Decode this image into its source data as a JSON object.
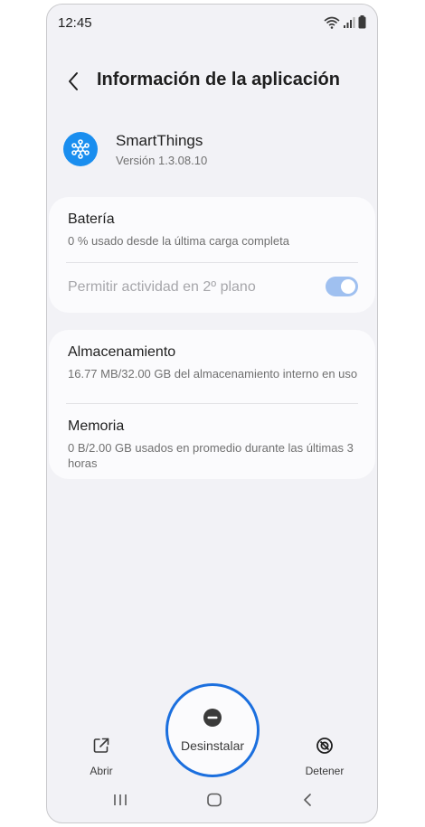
{
  "status_bar": {
    "time": "12:45",
    "icons": [
      "wifi-icon",
      "signal-icon",
      "battery-icon"
    ]
  },
  "header": {
    "title": "Información de la aplicación",
    "back_icon": "chevron-left-icon"
  },
  "app": {
    "name": "SmartThings",
    "version": "Versión 1.3.08.10",
    "icon": "smartthings-logo-icon",
    "icon_color": "#1a8eef"
  },
  "battery_card": {
    "title": "Batería",
    "subtitle": "0 % usado desde la última carga completa",
    "background_toggle_label": "Permitir actividad en 2º plano",
    "background_toggle_on": true
  },
  "storage_card": {
    "storage_title": "Almacenamiento",
    "storage_subtitle": "16.77 MB/32.00 GB del almacenamiento interno en uso",
    "memory_title": "Memoria",
    "memory_subtitle": "0 B/2.00 GB usados en promedio durante las últimas 3 horas"
  },
  "actions": {
    "open_label": "Abrir",
    "uninstall_label": "Desinstalar",
    "stop_label": "Detener"
  },
  "colors": {
    "accent": "#1b6fde",
    "toggle_track": "#9fc0f0",
    "background": "#f2f2f6",
    "card": "#fbfbfd"
  },
  "nav_bar": {
    "icons": [
      "recents-icon",
      "home-icon",
      "back-icon"
    ]
  }
}
